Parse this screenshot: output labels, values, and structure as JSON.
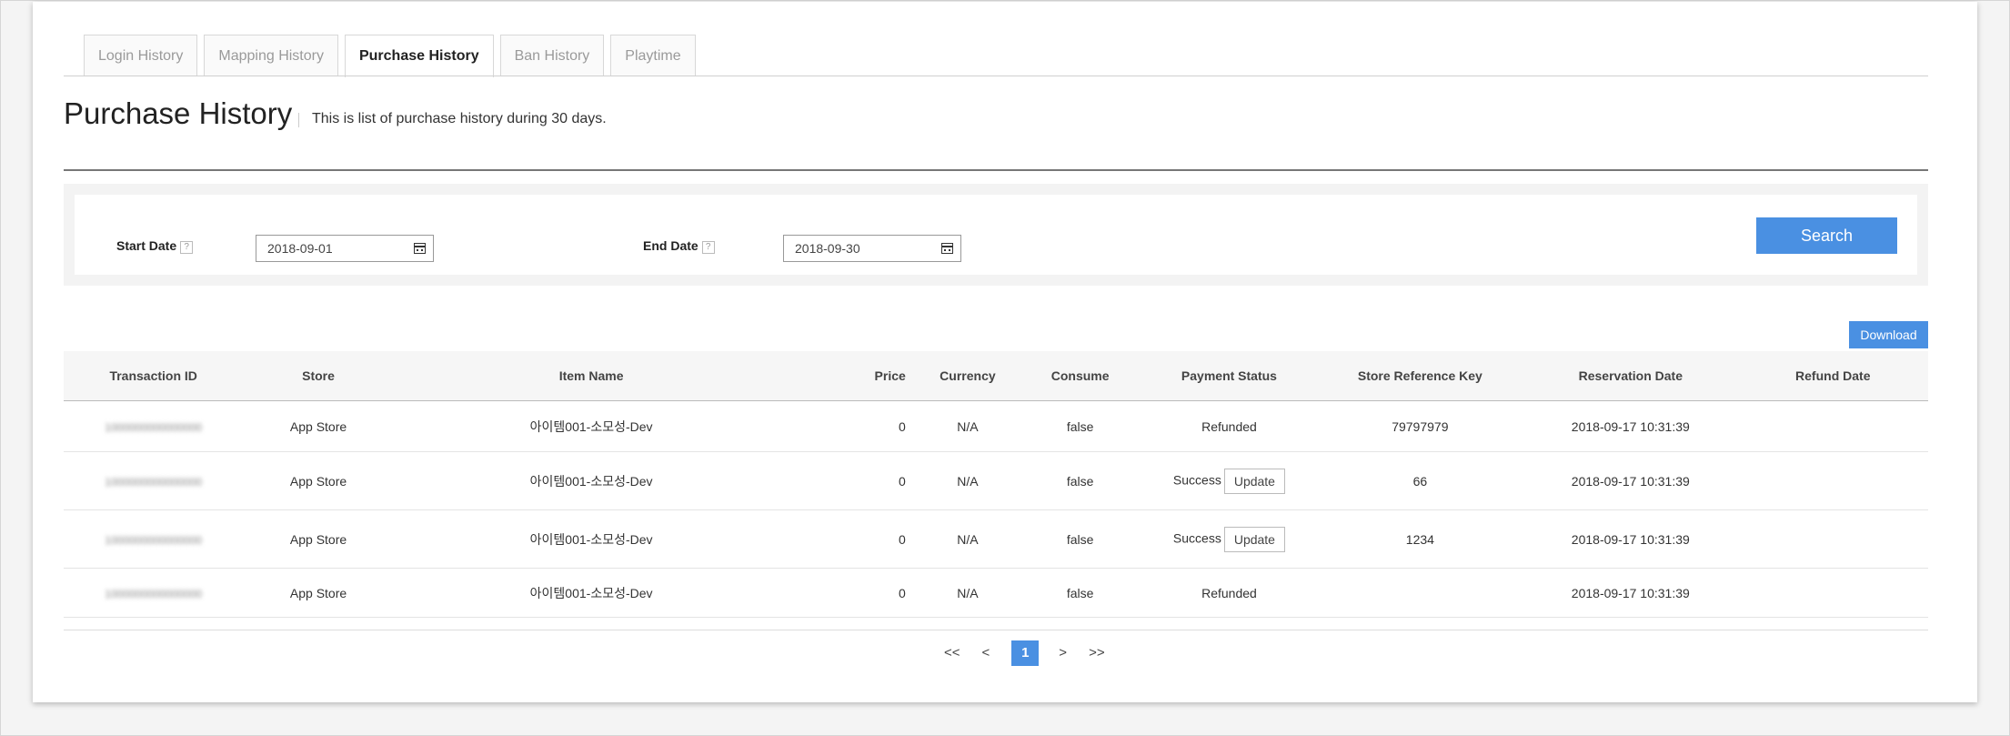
{
  "tabs": [
    {
      "label": "Login History",
      "active": false
    },
    {
      "label": "Mapping History",
      "active": false
    },
    {
      "label": "Purchase History",
      "active": true
    },
    {
      "label": "Ban History",
      "active": false
    },
    {
      "label": "Playtime",
      "active": false
    }
  ],
  "header": {
    "title": "Purchase History",
    "subtitle": "This is list of purchase history during 30 days."
  },
  "search": {
    "start_label": "Start Date",
    "start_value": "2018-09-01",
    "end_label": "End Date",
    "end_value": "2018-09-30",
    "help_glyph": "?",
    "button_label": "Search"
  },
  "download_label": "Download",
  "table": {
    "columns": [
      "Transaction ID",
      "Store",
      "Item Name",
      "Price",
      "Currency",
      "Consume",
      "Payment Status",
      "Store Reference Key",
      "Reservation Date",
      "Refund Date"
    ],
    "rows": [
      {
        "tx": "1000000000000000",
        "store": "App Store",
        "item": "아이템001-소모성-Dev",
        "price": "0",
        "currency": "N/A",
        "consume": "false",
        "status": "Refunded",
        "has_update": false,
        "ref_key": "79797979",
        "reserved": "2018-09-17 10:31:39",
        "refund": ""
      },
      {
        "tx": "1000000000000000",
        "store": "App Store",
        "item": "아이템001-소모성-Dev",
        "price": "0",
        "currency": "N/A",
        "consume": "false",
        "status": "Success",
        "has_update": true,
        "ref_key": "66",
        "reserved": "2018-09-17 10:31:39",
        "refund": ""
      },
      {
        "tx": "1000000000000000",
        "store": "App Store",
        "item": "아이템001-소모성-Dev",
        "price": "0",
        "currency": "N/A",
        "consume": "false",
        "status": "Success",
        "has_update": true,
        "ref_key": "1234",
        "reserved": "2018-09-17 10:31:39",
        "refund": ""
      },
      {
        "tx": "1000000000000000",
        "store": "App Store",
        "item": "아이템001-소모성-Dev",
        "price": "0",
        "currency": "N/A",
        "consume": "false",
        "status": "Refunded",
        "has_update": false,
        "ref_key": "",
        "reserved": "2018-09-17 10:31:39",
        "refund": ""
      }
    ],
    "update_label": "Update"
  },
  "pagination": {
    "first": "<<",
    "prev": "<",
    "current": "1",
    "next": ">",
    "last": ">>"
  },
  "colors": {
    "accent": "#4a90e2"
  }
}
